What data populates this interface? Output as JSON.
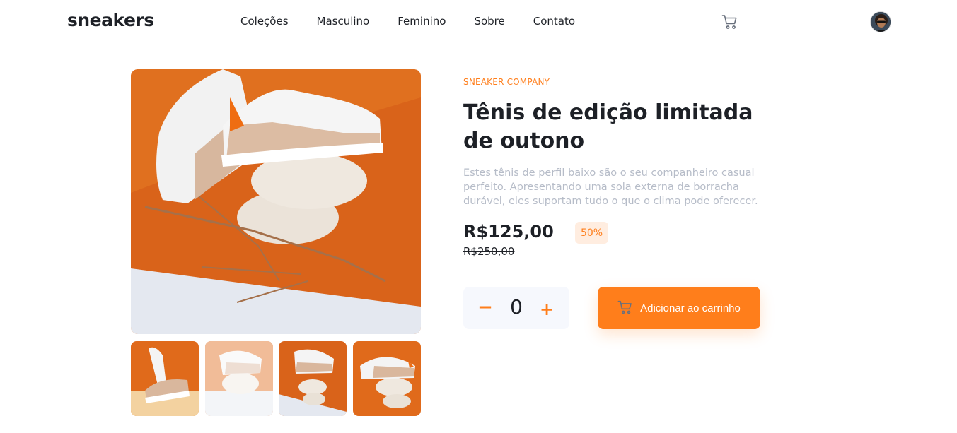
{
  "header": {
    "logo": "sneakers",
    "nav": [
      "Coleções",
      "Masculino",
      "Feminino",
      "Sobre",
      "Contato"
    ],
    "cart_icon": "cart-icon",
    "avatar_icon": "avatar"
  },
  "product": {
    "company": "SNEAKER COMPANY",
    "title": "Tênis de edição limitada de outono",
    "description": "Estes tênis de perfil baixo são o seu companheiro casual perfeito. Apresentando uma sola externa de borracha durável, eles suportam tudo o que o clima pode oferecer.",
    "price": "R$125,00",
    "discount": "50%",
    "old_price": "R$250,00"
  },
  "cart": {
    "quantity": "0",
    "minus": "−",
    "plus": "+",
    "add_label": "Adicionar ao carrinho"
  },
  "colors": {
    "accent": "#ff7e1b",
    "accent_pale": "#ffede0",
    "dark": "#1d2026",
    "muted": "#b6bcc8"
  }
}
